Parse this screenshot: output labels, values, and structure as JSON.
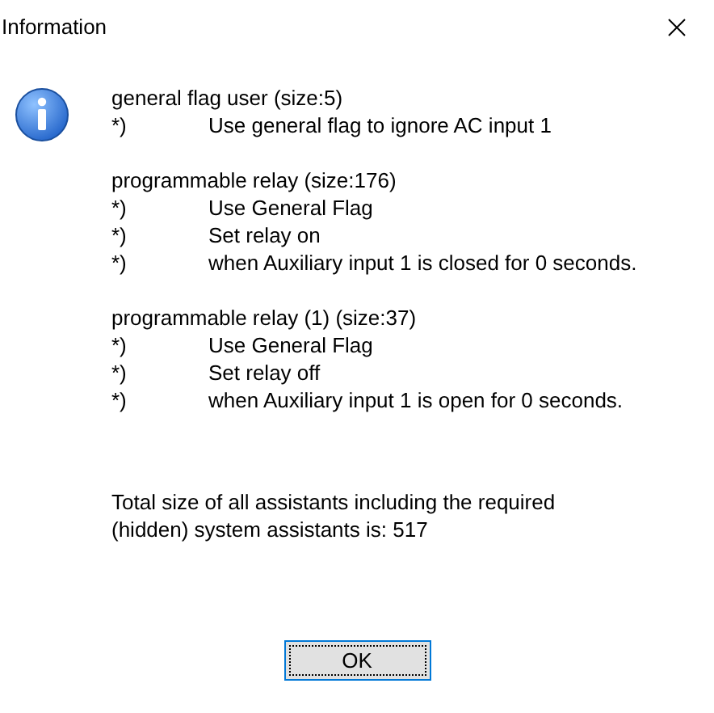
{
  "window": {
    "title": "Information"
  },
  "sections": [
    {
      "heading": "general flag user (size:5)",
      "items": [
        {
          "marker": "*)",
          "text": "Use general flag to ignore AC input 1"
        }
      ]
    },
    {
      "heading": "programmable relay (size:176)",
      "items": [
        {
          "marker": "*)",
          "text": "Use General Flag"
        },
        {
          "marker": "*)",
          "text": "Set relay on"
        },
        {
          "marker": "*)",
          "text": "when Auxiliary input 1 is closed for 0 seconds."
        }
      ]
    },
    {
      "heading": "programmable relay (1) (size:37)",
      "items": [
        {
          "marker": "*)",
          "text": "Use General Flag"
        },
        {
          "marker": "*)",
          "text": "Set relay off"
        },
        {
          "marker": "*)",
          "text": "when Auxiliary input 1 is open for 0 seconds."
        }
      ]
    }
  ],
  "summary": "Total size of all assistants including the required (hidden) system assistants is: 517",
  "buttons": [
    {
      "label": "OK"
    }
  ]
}
